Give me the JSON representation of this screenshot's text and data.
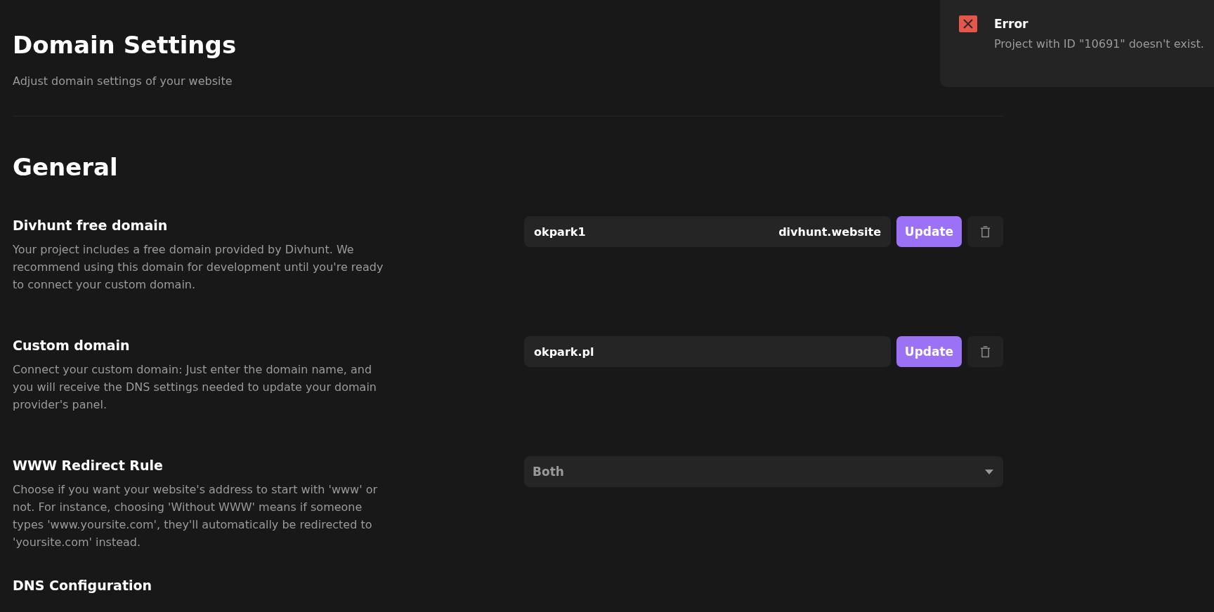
{
  "header": {
    "title": "Domain Settings",
    "subtitle": "Adjust domain settings of your website"
  },
  "section": {
    "title": "General"
  },
  "settings": [
    {
      "kind": "domain",
      "label": "Divhunt free domain",
      "description": "Your project includes a free domain provided by Divhunt. We recommend using this domain for development until you're ready to connect your custom domain.",
      "value": "okpark1",
      "suffix": "divhunt.website",
      "button": "Update"
    },
    {
      "kind": "text",
      "label": "Custom domain",
      "description": "Connect your custom domain: Just enter the domain name, and you will receive the DNS settings needed to update your domain provider's panel.",
      "value": "okpark.pl",
      "button": "Update"
    },
    {
      "kind": "select",
      "label": "WWW Redirect Rule",
      "description": "Choose if you want your website's address to start with 'www' or not. For instance, choosing 'Without WWW' means if someone types 'www.yoursite.com', they'll automatically be redirected to 'yoursite.com' instead.",
      "value": "Both"
    },
    {
      "kind": "heading",
      "label": "DNS Configuration"
    }
  ],
  "toast": {
    "title": "Error",
    "message": "Project with ID \"10691\" doesn't exist."
  }
}
